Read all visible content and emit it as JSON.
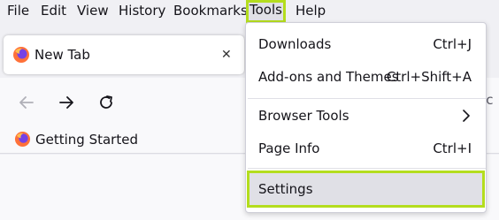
{
  "menubar": {
    "items": [
      {
        "label": "File"
      },
      {
        "label": "Edit"
      },
      {
        "label": "View"
      },
      {
        "label": "History"
      },
      {
        "label": "Bookmarks"
      },
      {
        "label": "Tools"
      },
      {
        "label": "Help"
      }
    ]
  },
  "tab": {
    "title": "New Tab",
    "close_glyph": "✕",
    "favicon": "firefox-icon"
  },
  "navbar": {
    "back_icon": "arrow-left-icon",
    "forward_icon": "arrow-right-icon",
    "reload_icon": "reload-icon",
    "url_fragment": "ac"
  },
  "bookmarks": {
    "items": [
      {
        "label": "Getting Started",
        "icon": "firefox-icon"
      }
    ]
  },
  "tools_menu": {
    "items": [
      {
        "label": "Downloads",
        "shortcut": "Ctrl+J"
      },
      {
        "label": "Add-ons and Themes",
        "shortcut": "Ctrl+Shift+A"
      },
      {
        "label": "Browser Tools",
        "shortcut": ""
      },
      {
        "label": "Page Info",
        "shortcut": "Ctrl+I"
      },
      {
        "label": "Settings",
        "shortcut": ""
      }
    ]
  },
  "colors": {
    "highlight_outline": "#b4dd1e",
    "firefox_orange": "#ff7139",
    "firefox_purple": "#7542e5"
  }
}
